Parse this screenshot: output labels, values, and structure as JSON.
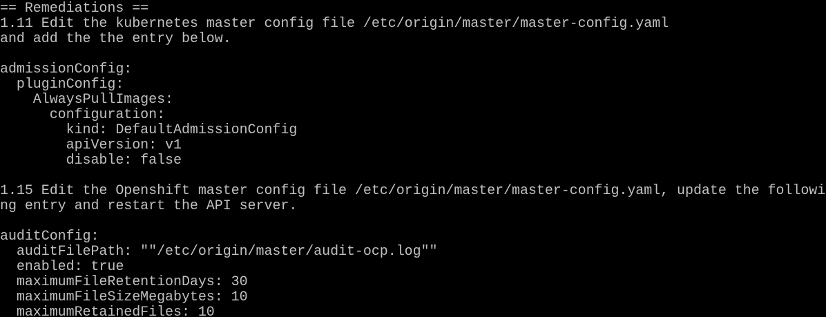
{
  "terminal": {
    "colors": {
      "background": "#000000",
      "foreground": "#c0c0c0"
    },
    "lines": [
      "== Remediations ==",
      "1.11 Edit the kubernetes master config file /etc/origin/master/master-config.yaml",
      "and add the the entry below.",
      "",
      "admissionConfig:",
      "  pluginConfig:",
      "    AlwaysPullImages:",
      "      configuration:",
      "        kind: DefaultAdmissionConfig",
      "        apiVersion: v1",
      "        disable: false",
      "",
      "1.15 Edit the Openshift master config file /etc/origin/master/master-config.yaml, update the followi",
      "ng entry and restart the API server.",
      "",
      "auditConfig:",
      "  auditFilePath: \"\"/etc/origin/master/audit-ocp.log\"\"",
      "  enabled: true",
      "  maximumFileRetentionDays: 30",
      "  maximumFileSizeMegabytes: 10",
      "  maximumRetainedFiles: 10"
    ]
  }
}
